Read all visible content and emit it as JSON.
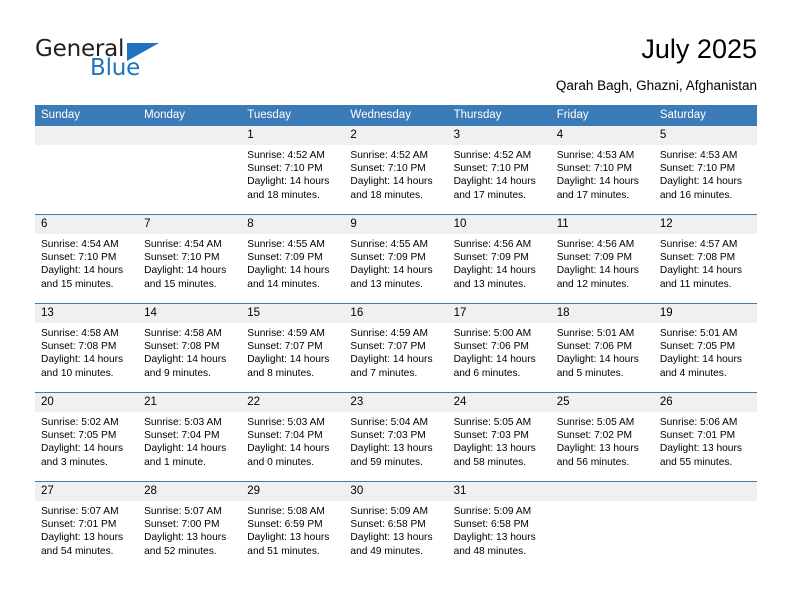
{
  "brand": {
    "word1": "General",
    "word2": "Blue",
    "accent_color": "#1f72bd"
  },
  "header": {
    "title": "July 2025",
    "location": "Qarah Bagh, Ghazni, Afghanistan"
  },
  "calendar": {
    "header_bg": "#3b7cb8",
    "daynum_bg": "#f0f0f0",
    "weekday_headers": [
      "Sunday",
      "Monday",
      "Tuesday",
      "Wednesday",
      "Thursday",
      "Friday",
      "Saturday"
    ],
    "labels": {
      "sunrise": "Sunrise:",
      "sunset": "Sunset:",
      "daylight": "Daylight:"
    },
    "weeks": [
      [
        {
          "day": "",
          "empty": true
        },
        {
          "day": "",
          "empty": true
        },
        {
          "day": "1",
          "sunrise": "Sunrise: 4:52 AM",
          "sunset": "Sunset: 7:10 PM",
          "daylight": "Daylight: 14 hours and 18 minutes."
        },
        {
          "day": "2",
          "sunrise": "Sunrise: 4:52 AM",
          "sunset": "Sunset: 7:10 PM",
          "daylight": "Daylight: 14 hours and 18 minutes."
        },
        {
          "day": "3",
          "sunrise": "Sunrise: 4:52 AM",
          "sunset": "Sunset: 7:10 PM",
          "daylight": "Daylight: 14 hours and 17 minutes."
        },
        {
          "day": "4",
          "sunrise": "Sunrise: 4:53 AM",
          "sunset": "Sunset: 7:10 PM",
          "daylight": "Daylight: 14 hours and 17 minutes."
        },
        {
          "day": "5",
          "sunrise": "Sunrise: 4:53 AM",
          "sunset": "Sunset: 7:10 PM",
          "daylight": "Daylight: 14 hours and 16 minutes."
        }
      ],
      [
        {
          "day": "6",
          "sunrise": "Sunrise: 4:54 AM",
          "sunset": "Sunset: 7:10 PM",
          "daylight": "Daylight: 14 hours and 15 minutes."
        },
        {
          "day": "7",
          "sunrise": "Sunrise: 4:54 AM",
          "sunset": "Sunset: 7:10 PM",
          "daylight": "Daylight: 14 hours and 15 minutes."
        },
        {
          "day": "8",
          "sunrise": "Sunrise: 4:55 AM",
          "sunset": "Sunset: 7:09 PM",
          "daylight": "Daylight: 14 hours and 14 minutes."
        },
        {
          "day": "9",
          "sunrise": "Sunrise: 4:55 AM",
          "sunset": "Sunset: 7:09 PM",
          "daylight": "Daylight: 14 hours and 13 minutes."
        },
        {
          "day": "10",
          "sunrise": "Sunrise: 4:56 AM",
          "sunset": "Sunset: 7:09 PM",
          "daylight": "Daylight: 14 hours and 13 minutes."
        },
        {
          "day": "11",
          "sunrise": "Sunrise: 4:56 AM",
          "sunset": "Sunset: 7:09 PM",
          "daylight": "Daylight: 14 hours and 12 minutes."
        },
        {
          "day": "12",
          "sunrise": "Sunrise: 4:57 AM",
          "sunset": "Sunset: 7:08 PM",
          "daylight": "Daylight: 14 hours and 11 minutes."
        }
      ],
      [
        {
          "day": "13",
          "sunrise": "Sunrise: 4:58 AM",
          "sunset": "Sunset: 7:08 PM",
          "daylight": "Daylight: 14 hours and 10 minutes."
        },
        {
          "day": "14",
          "sunrise": "Sunrise: 4:58 AM",
          "sunset": "Sunset: 7:08 PM",
          "daylight": "Daylight: 14 hours and 9 minutes."
        },
        {
          "day": "15",
          "sunrise": "Sunrise: 4:59 AM",
          "sunset": "Sunset: 7:07 PM",
          "daylight": "Daylight: 14 hours and 8 minutes."
        },
        {
          "day": "16",
          "sunrise": "Sunrise: 4:59 AM",
          "sunset": "Sunset: 7:07 PM",
          "daylight": "Daylight: 14 hours and 7 minutes."
        },
        {
          "day": "17",
          "sunrise": "Sunrise: 5:00 AM",
          "sunset": "Sunset: 7:06 PM",
          "daylight": "Daylight: 14 hours and 6 minutes."
        },
        {
          "day": "18",
          "sunrise": "Sunrise: 5:01 AM",
          "sunset": "Sunset: 7:06 PM",
          "daylight": "Daylight: 14 hours and 5 minutes."
        },
        {
          "day": "19",
          "sunrise": "Sunrise: 5:01 AM",
          "sunset": "Sunset: 7:05 PM",
          "daylight": "Daylight: 14 hours and 4 minutes."
        }
      ],
      [
        {
          "day": "20",
          "sunrise": "Sunrise: 5:02 AM",
          "sunset": "Sunset: 7:05 PM",
          "daylight": "Daylight: 14 hours and 3 minutes."
        },
        {
          "day": "21",
          "sunrise": "Sunrise: 5:03 AM",
          "sunset": "Sunset: 7:04 PM",
          "daylight": "Daylight: 14 hours and 1 minute."
        },
        {
          "day": "22",
          "sunrise": "Sunrise: 5:03 AM",
          "sunset": "Sunset: 7:04 PM",
          "daylight": "Daylight: 14 hours and 0 minutes."
        },
        {
          "day": "23",
          "sunrise": "Sunrise: 5:04 AM",
          "sunset": "Sunset: 7:03 PM",
          "daylight": "Daylight: 13 hours and 59 minutes."
        },
        {
          "day": "24",
          "sunrise": "Sunrise: 5:05 AM",
          "sunset": "Sunset: 7:03 PM",
          "daylight": "Daylight: 13 hours and 58 minutes."
        },
        {
          "day": "25",
          "sunrise": "Sunrise: 5:05 AM",
          "sunset": "Sunset: 7:02 PM",
          "daylight": "Daylight: 13 hours and 56 minutes."
        },
        {
          "day": "26",
          "sunrise": "Sunrise: 5:06 AM",
          "sunset": "Sunset: 7:01 PM",
          "daylight": "Daylight: 13 hours and 55 minutes."
        }
      ],
      [
        {
          "day": "27",
          "sunrise": "Sunrise: 5:07 AM",
          "sunset": "Sunset: 7:01 PM",
          "daylight": "Daylight: 13 hours and 54 minutes."
        },
        {
          "day": "28",
          "sunrise": "Sunrise: 5:07 AM",
          "sunset": "Sunset: 7:00 PM",
          "daylight": "Daylight: 13 hours and 52 minutes."
        },
        {
          "day": "29",
          "sunrise": "Sunrise: 5:08 AM",
          "sunset": "Sunset: 6:59 PM",
          "daylight": "Daylight: 13 hours and 51 minutes."
        },
        {
          "day": "30",
          "sunrise": "Sunrise: 5:09 AM",
          "sunset": "Sunset: 6:58 PM",
          "daylight": "Daylight: 13 hours and 49 minutes."
        },
        {
          "day": "31",
          "sunrise": "Sunrise: 5:09 AM",
          "sunset": "Sunset: 6:58 PM",
          "daylight": "Daylight: 13 hours and 48 minutes."
        },
        {
          "day": "",
          "empty": true
        },
        {
          "day": "",
          "empty": true
        }
      ]
    ]
  }
}
